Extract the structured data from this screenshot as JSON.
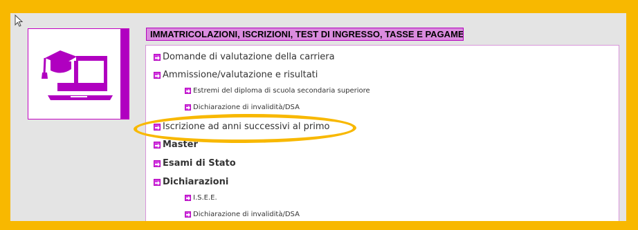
{
  "colors": {
    "frame": "#f8b800",
    "background": "#e4e4e4",
    "accent": "#b000c0",
    "header_fill": "#da8bde",
    "link_text": "#333333"
  },
  "section": {
    "title": "IMMATRICOLAZIONI, ISCRIZIONI, TEST DI INGRESSO, TASSE E PAGAMENTI"
  },
  "icons": {
    "cursor": "mouse-pointer-icon",
    "logo": "graduation-laptop-icon",
    "bullet": "arrow-right-box-icon"
  },
  "links": [
    {
      "label": "Domande di valutazione della carriera"
    },
    {
      "label": "Ammissione/valutazione e risultati"
    },
    {
      "label": "Estremi del diploma di scuola secondaria superiore"
    },
    {
      "label": "Dichiarazione di invalidità/DSA"
    },
    {
      "label": "Iscrizione ad anni successivi al primo"
    },
    {
      "label": "Master"
    },
    {
      "label": "Esami di Stato"
    },
    {
      "label": "Dichiarazioni"
    },
    {
      "label": "I.S.E.E."
    },
    {
      "label": "Dichiarazione di invalidità/DSA"
    }
  ]
}
